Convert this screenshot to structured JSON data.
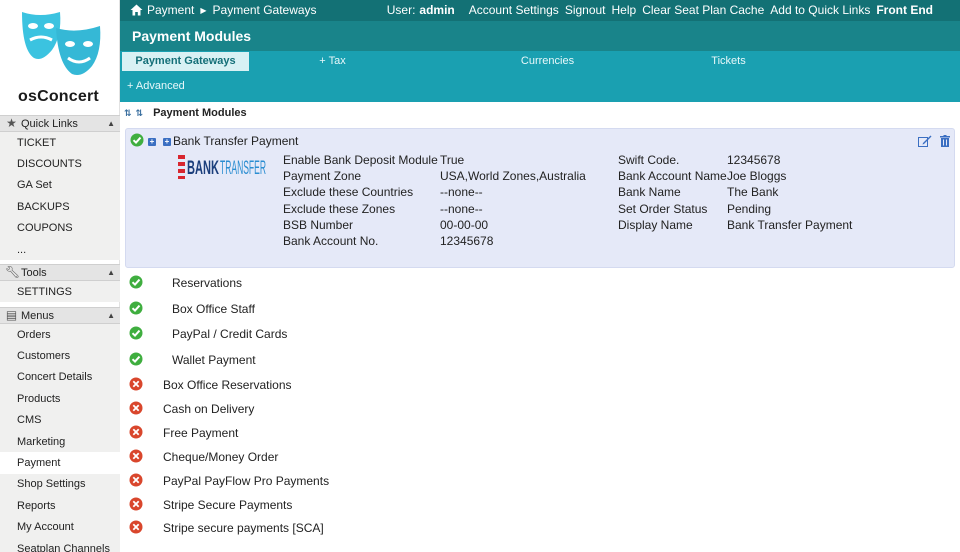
{
  "app": {
    "logo_text": "osConcert"
  },
  "sidebar": {
    "sections": [
      {
        "title": "Quick Links",
        "icon": "star-icon",
        "items": [
          "TICKET",
          "DISCOUNTS",
          "GA Set",
          "BACKUPS",
          "COUPONS",
          "..."
        ]
      },
      {
        "title": "Tools",
        "icon": "wrench-icon",
        "items": [
          "SETTINGS"
        ]
      },
      {
        "title": "Menus",
        "icon": "list-icon",
        "items": [
          "Orders",
          "Customers",
          "Concert Details",
          "Products",
          "CMS",
          "Marketing",
          "Payment",
          "Shop Settings",
          "Reports",
          "My Account",
          "Seatplan Channels"
        ],
        "active": "Payment"
      }
    ]
  },
  "topbar": {
    "breadcrumb": [
      "Payment",
      "Payment Gateways"
    ],
    "user_label": "User:",
    "user_name": "admin",
    "links": [
      "Account Settings",
      "Signout",
      "Help",
      "Clear Seat Plan Cache",
      "Add to Quick Links"
    ],
    "front_end": "Front End"
  },
  "page": {
    "title": "Payment Modules",
    "tabs": [
      "Payment Gateways",
      "+ Tax",
      "Currencies",
      "Tickets"
    ],
    "active_tab": "Payment Gateways",
    "advanced": "+ Advanced",
    "list_header": "Payment Modules"
  },
  "expanded_module": {
    "title": "Bank Transfer Payment",
    "logo_text": "BANK TRANSFER",
    "left_fields": [
      {
        "label": "Enable Bank Deposit Module",
        "value": "True"
      },
      {
        "label": "Payment Zone",
        "value": "USA,World Zones,Australia"
      },
      {
        "label": "Exclude these Countries",
        "value": "--none--"
      },
      {
        "label": "Exclude these Zones",
        "value": "--none--"
      },
      {
        "label": "BSB Number",
        "value": "00-00-00"
      },
      {
        "label": "Bank Account No.",
        "value": "12345678"
      }
    ],
    "right_fields": [
      {
        "label": "Swift Code.",
        "value": "12345678"
      },
      {
        "label": "Bank Account Name",
        "value": "Joe Bloggs"
      },
      {
        "label": "Bank Name",
        "value": "The Bank"
      },
      {
        "label": "Set Order Status",
        "value": "Pending"
      },
      {
        "label": "Display Name",
        "value": "Bank Transfer Payment"
      }
    ]
  },
  "modules": [
    {
      "name": "Reservations",
      "status": "enabled"
    },
    {
      "name": "Box Office Staff",
      "status": "enabled"
    },
    {
      "name": "PayPal / Credit Cards",
      "status": "enabled"
    },
    {
      "name": "Wallet Payment",
      "status": "enabled"
    },
    {
      "name": "Box Office Reservations",
      "status": "disabled"
    },
    {
      "name": "Cash on Delivery",
      "status": "disabled"
    },
    {
      "name": "Free Payment",
      "status": "disabled"
    },
    {
      "name": "Cheque/Money Order",
      "status": "disabled"
    },
    {
      "name": "PayPal PayFlow Pro Payments",
      "status": "disabled"
    },
    {
      "name": "Stripe Secure Payments",
      "status": "disabled"
    },
    {
      "name": "Stripe secure payments [SCA]",
      "status": "disabled"
    }
  ],
  "colors": {
    "topbar": "#137175",
    "titlebar": "#19848a",
    "tabsbar": "#1aa0b1",
    "panel": "#e5e9f8",
    "enabled": "#3fae3f",
    "disabled": "#d9462c"
  }
}
